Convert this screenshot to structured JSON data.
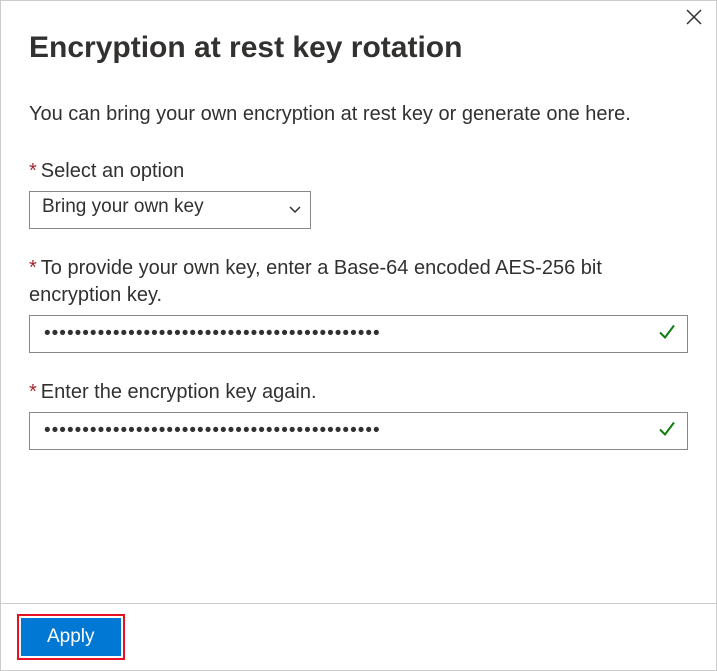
{
  "dialog": {
    "title": "Encryption at rest key rotation",
    "description": "You can bring your own encryption at rest key or generate one here."
  },
  "fields": {
    "option": {
      "label": "Select an option",
      "selected": "Bring your own key"
    },
    "key": {
      "label": "To provide your own key, enter a Base-64 encoded AES-256 bit encryption key.",
      "value": "••••••••••••••••••••••••••••••••••••••••••••"
    },
    "keyConfirm": {
      "label": "Enter the encryption key again.",
      "value": "••••••••••••••••••••••••••••••••••••••••••••"
    }
  },
  "footer": {
    "apply": "Apply"
  }
}
